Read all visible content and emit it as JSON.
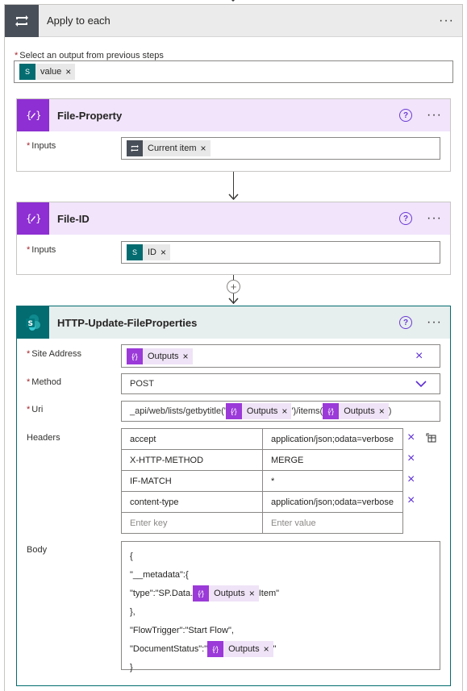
{
  "apply_to_each": {
    "title": "Apply to each",
    "select_label": "Select an output from previous steps",
    "select_token": "value"
  },
  "file_property": {
    "title": "File-Property",
    "inputs_label": "Inputs",
    "token": "Current item"
  },
  "file_id": {
    "title": "File-ID",
    "inputs_label": "Inputs",
    "token": "ID"
  },
  "http_update": {
    "title": "HTTP-Update-FileProperties",
    "site_address_label": "Site Address",
    "site_address_token": "Outputs",
    "method_label": "Method",
    "method_value": "POST",
    "uri_label": "Uri",
    "uri_prefix": "_api/web/lists/getbytitle('",
    "uri_token1": "Outputs",
    "uri_middle": "')/items(",
    "uri_token2": "Outputs",
    "uri_suffix": ")",
    "headers_label": "Headers",
    "headers": [
      {
        "key": "accept",
        "value": "application/json;odata=verbose"
      },
      {
        "key": "X-HTTP-METHOD",
        "value": "MERGE"
      },
      {
        "key": "IF-MATCH",
        "value": "*"
      },
      {
        "key": "content-type",
        "value": "application/json;odata=verbose"
      }
    ],
    "header_key_placeholder": "Enter key",
    "header_value_placeholder": "Enter value",
    "body_label": "Body",
    "body": {
      "line1": "{",
      "line2": "\"__metadata\":{",
      "line3_prefix": "\"type\":\"SP.Data.",
      "line3_token": "Outputs",
      "line3_suffix": "Item\"",
      "line4": "},",
      "line5": "\"FlowTrigger\":\"Start Flow\",",
      "line6_prefix": "\"DocumentStatus\":\"",
      "line6_token": "Outputs",
      "line6_suffix": "\"",
      "line7": "}"
    }
  },
  "glyphs": {
    "more": "···",
    "help": "?",
    "close": "×",
    "plus": "+"
  },
  "colors": {
    "accent": "#5c2dd3",
    "compose_purple": "#8d2fd2",
    "sharepoint_teal": "#036c70",
    "loop_slate": "#484f58"
  }
}
